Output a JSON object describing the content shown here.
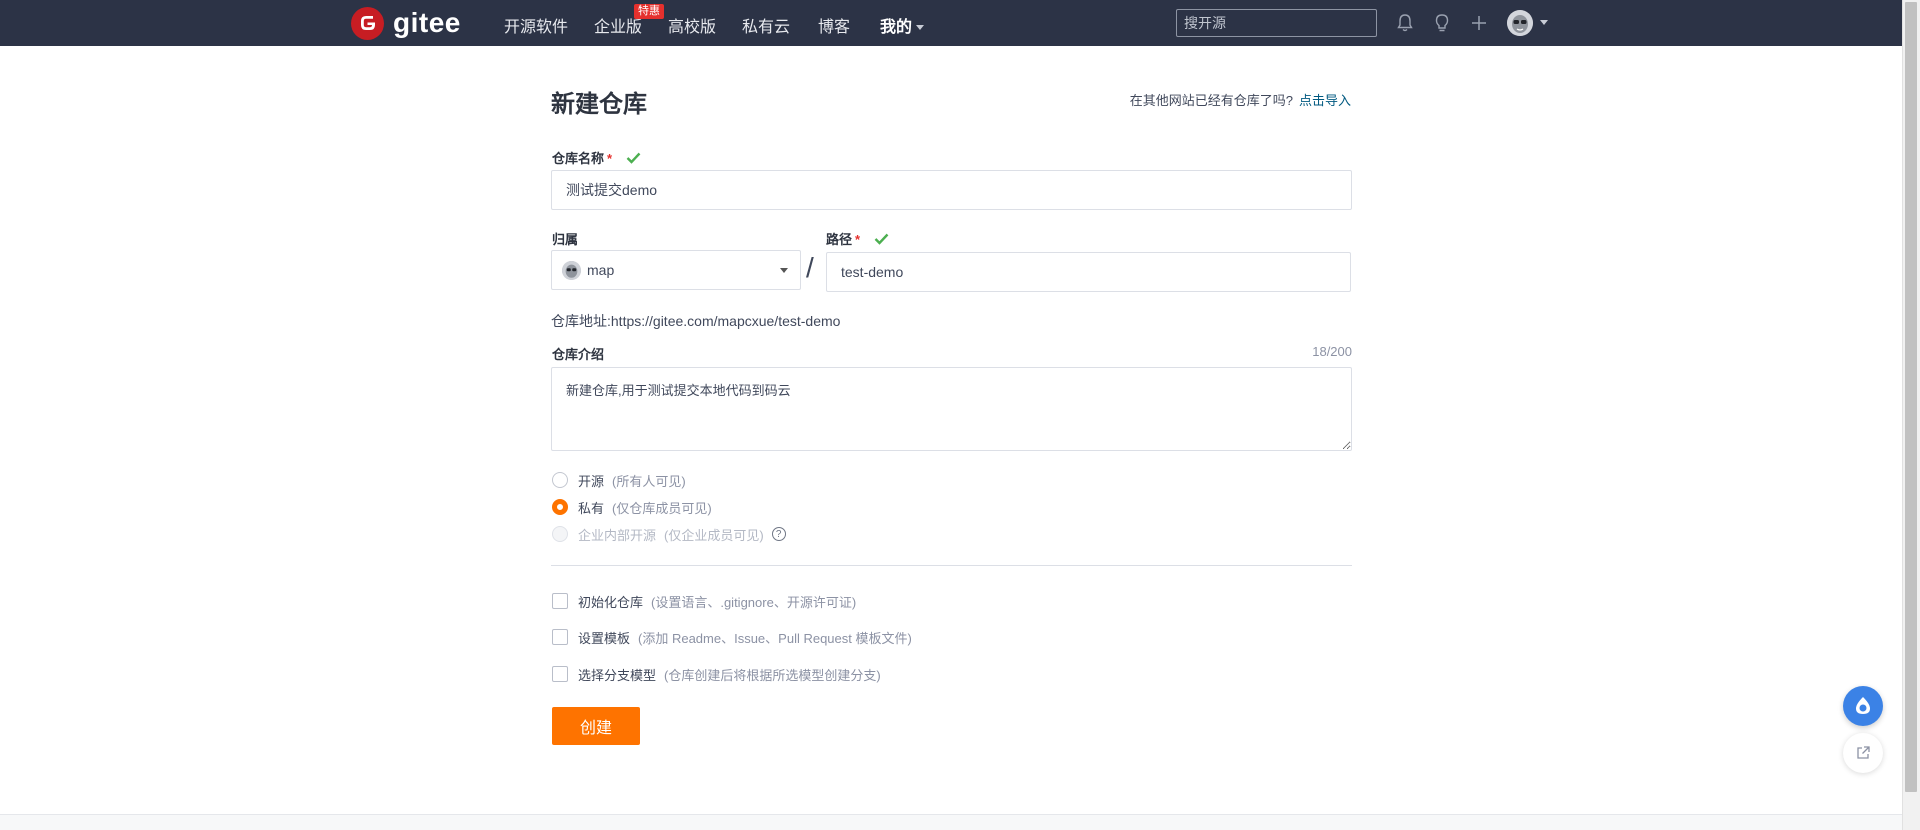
{
  "navbar": {
    "brand": "gitee",
    "items": [
      {
        "label": "开源软件"
      },
      {
        "label": "企业版"
      },
      {
        "label": "高校版"
      },
      {
        "label": "私有云"
      },
      {
        "label": "博客"
      },
      {
        "label": "我的"
      }
    ],
    "enterprise_badge": "特惠",
    "search_placeholder": "搜开源",
    "icons": [
      "bell-icon",
      "lightbulb-icon",
      "plus-icon",
      "avatar"
    ]
  },
  "form": {
    "title": "新建仓库",
    "import_hint": "在其他网站已经有仓库了吗?",
    "import_link": "点击导入",
    "repo_name_label": "仓库名称",
    "repo_name_value": "测试提交demo",
    "owner_label": "归属",
    "owner_value": "map",
    "path_label": "路径",
    "path_value": "test-demo",
    "separator": "/",
    "address_label": "仓库地址:",
    "address_value": "https://gitee.com/mapcxue/test-demo",
    "description_label": "仓库介绍",
    "description_counter": "18/200",
    "description_value": "新建仓库,用于测试提交本地代码到码云",
    "visibility": [
      {
        "label": "开源",
        "hint": "(所有人可见)",
        "checked": false,
        "disabled": false
      },
      {
        "label": "私有",
        "hint": "(仅仓库成员可见)",
        "checked": true,
        "disabled": false
      },
      {
        "label": "企业内部开源",
        "hint": "(仅企业成员可见)",
        "checked": false,
        "disabled": true
      }
    ],
    "help_glyph": "?",
    "options": [
      {
        "label": "初始化仓库",
        "hint": "(设置语言、.gitignore、开源许可证)",
        "checked": false
      },
      {
        "label": "设置模板",
        "hint": "(添加 Readme、Issue、Pull Request 模板文件)",
        "checked": false
      },
      {
        "label": "选择分支模型",
        "hint": "(仓库创建后将根据所选模型创建分支)",
        "checked": false
      }
    ],
    "submit_label": "创建"
  },
  "colors": {
    "navbar_bg": "#2c3346",
    "accent": "#fe7300",
    "brand_red": "#c71d23",
    "link": "#005980",
    "check_green": "#4caf50"
  }
}
